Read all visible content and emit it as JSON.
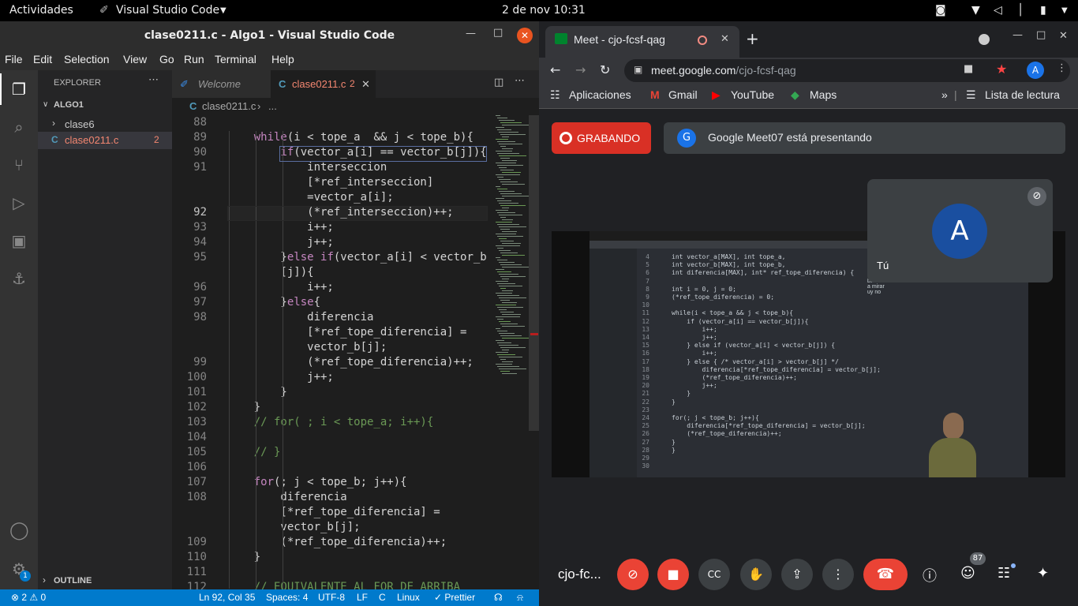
{
  "topbar": {
    "activities": "Actividades",
    "app": "Visual Studio Code",
    "clock": "2 de nov  10:31"
  },
  "vscode": {
    "title": "clase0211.c - Algo1 - Visual Studio Code",
    "menu": [
      "File",
      "Edit",
      "Selection",
      "View",
      "Go",
      "Run",
      "Terminal",
      "Help"
    ],
    "explorer": {
      "header": "EXPLORER",
      "folder": "ALGO1",
      "items": [
        "clase6",
        "clase0211.c"
      ],
      "badge": "2",
      "outline": "OUTLINE"
    },
    "tabs": {
      "welcome": "Welcome",
      "file": "clase0211.c",
      "file_badge": "2"
    },
    "breadcrumb": "clase0211.c",
    "breadcrumb_more": "...",
    "code_rows": [
      {
        "n": "88",
        "t": ""
      },
      {
        "n": "89",
        "t": "    while(i < tope_a  && j < tope_b){"
      },
      {
        "n": "90",
        "t": "        if(vector_a[i] == vector_b[j]){"
      },
      {
        "n": "91",
        "t": "            interseccion"
      },
      {
        "n": "",
        "t": "            [*ref_interseccion]"
      },
      {
        "n": "",
        "t": "            =vector_a[i];"
      },
      {
        "n": "92",
        "t": "            (*ref_interseccion)++;"
      },
      {
        "n": "93",
        "t": "            i++;"
      },
      {
        "n": "94",
        "t": "            j++;"
      },
      {
        "n": "95",
        "t": "        }else if(vector_a[i] < vector_b"
      },
      {
        "n": "",
        "t": "        [j]){"
      },
      {
        "n": "96",
        "t": "            i++;"
      },
      {
        "n": "97",
        "t": "        }else{"
      },
      {
        "n": "98",
        "t": "            diferencia"
      },
      {
        "n": "",
        "t": "            [*ref_tope_diferencia] ="
      },
      {
        "n": "",
        "t": "            vector_b[j];"
      },
      {
        "n": "99",
        "t": "            (*ref_tope_diferencia)++;"
      },
      {
        "n": "100",
        "t": "            j++;"
      },
      {
        "n": "101",
        "t": "        }"
      },
      {
        "n": "102",
        "t": "    }"
      },
      {
        "n": "103",
        "t": "    // for( ; i < tope_a; i++){"
      },
      {
        "n": "104",
        "t": ""
      },
      {
        "n": "105",
        "t": "    // }"
      },
      {
        "n": "106",
        "t": ""
      },
      {
        "n": "107",
        "t": "    for(; j < tope_b; j++){"
      },
      {
        "n": "108",
        "t": "        diferencia"
      },
      {
        "n": "",
        "t": "        [*ref_tope_diferencia] ="
      },
      {
        "n": "",
        "t": "        vector_b[j];"
      },
      {
        "n": "109",
        "t": "        (*ref_tope_diferencia)++;"
      },
      {
        "n": "110",
        "t": "    }"
      },
      {
        "n": "111",
        "t": ""
      },
      {
        "n": "112",
        "t": "    // EQUIVALENTE AL FOR DE ARRIBA"
      }
    ],
    "status": {
      "problems": "2",
      "warnings": "0",
      "position": "Ln 92, Col 35",
      "spaces": "Spaces: 4",
      "encoding": "UTF-8",
      "eol": "LF",
      "lang": "C",
      "os": "Linux",
      "formatter": "Prettier"
    },
    "settings_badge": "1"
  },
  "chrome": {
    "tab_title": "Meet - cjo-fcsf-qag",
    "url_host": "meet.google.com",
    "url_path": "/cjo-fcsf-qag",
    "avatar": "A",
    "bookmarks": [
      "Aplicaciones",
      "Gmail",
      "YouTube",
      "Maps"
    ],
    "reading_list": "Lista de lectura",
    "overflow": "»"
  },
  "meet": {
    "recording": "GRABANDO",
    "presenting_avatar": "G",
    "presenting": "Google Meet07 está presentando",
    "self_initial": "A",
    "self_label": "Tú",
    "meeting_code": "cjo-fc...",
    "participants": "87",
    "shared_code": [
      {
        "n": "4",
        "t": "int vector_a[MAX], int tope_a,"
      },
      {
        "n": "5",
        "t": "int vector_b[MAX], int tope_b,"
      },
      {
        "n": "6",
        "t": "int diferencia[MAX], int* ref_tope_diferencia) {"
      },
      {
        "n": "7",
        "t": ""
      },
      {
        "n": "8",
        "t": "int i = 0, j = 0;"
      },
      {
        "n": "9",
        "t": "(*ref_tope_diferencia) = 0;"
      },
      {
        "n": "10",
        "t": ""
      },
      {
        "n": "11",
        "t": "while(i < tope_a && j < tope_b){"
      },
      {
        "n": "12",
        "t": "    if (vector_a[i] == vector_b[j]){"
      },
      {
        "n": "13",
        "t": "        i++;"
      },
      {
        "n": "14",
        "t": "        j++;"
      },
      {
        "n": "15",
        "t": "    } else if (vector_a[i] < vector_b[j]) {"
      },
      {
        "n": "16",
        "t": "        i++;"
      },
      {
        "n": "17",
        "t": "    } else { /* vector_a[i] > vector_b[j] */"
      },
      {
        "n": "18",
        "t": "        diferencia[*ref_tope_diferencia] = vector_b[j];"
      },
      {
        "n": "19",
        "t": "        (*ref_tope_diferencia)++;"
      },
      {
        "n": "20",
        "t": "        j++;"
      },
      {
        "n": "21",
        "t": "    }"
      },
      {
        "n": "22",
        "t": "}"
      },
      {
        "n": "23",
        "t": ""
      },
      {
        "n": "24",
        "t": "for(; j < tope_b; j++){"
      },
      {
        "n": "25",
        "t": "    diferencia[*ref_tope_diferencia] = vector_b[j];"
      },
      {
        "n": "26",
        "t": "    (*ref_tope_diferencia)++;"
      },
      {
        "n": "27",
        "t": "}"
      },
      {
        "n": "28",
        "t": "}"
      },
      {
        "n": "29",
        "t": ""
      },
      {
        "n": "30",
        "t": ""
      }
    ],
    "chat_snippets": [
      "ban",
      "a mirar",
      "uy no"
    ]
  }
}
